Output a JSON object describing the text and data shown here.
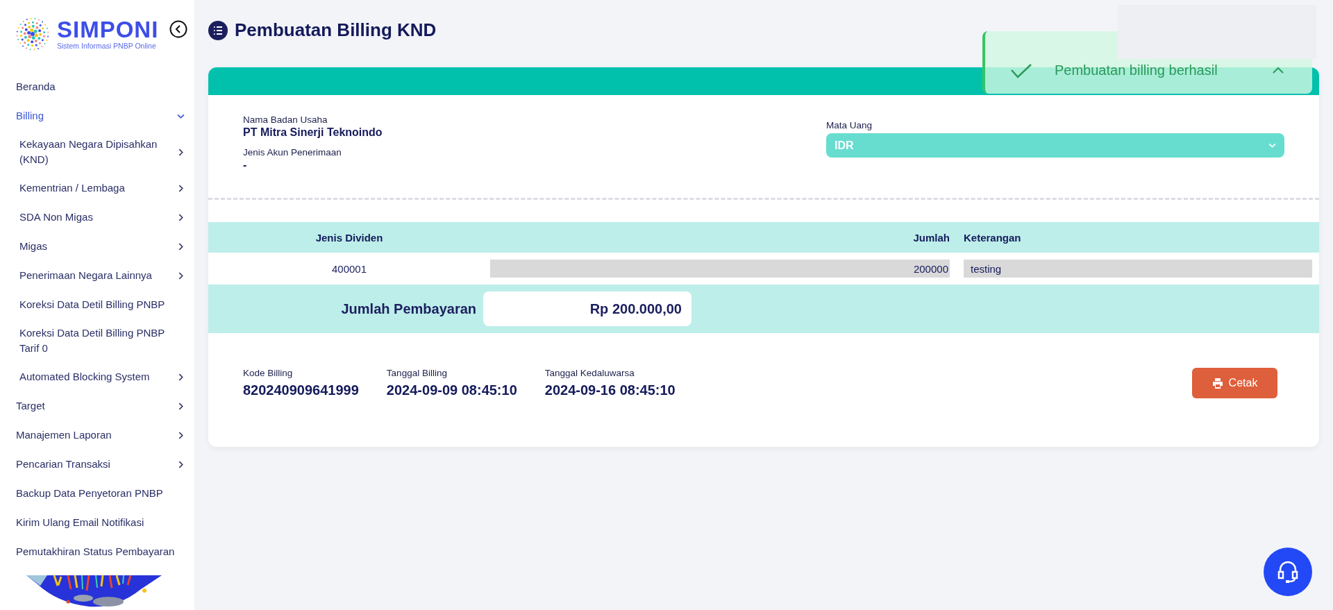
{
  "logo": {
    "name": "SIMPONI",
    "tagline": "Sistem Informasi PNBP Online"
  },
  "sidebar": {
    "items": [
      {
        "label": "Beranda",
        "selected": false
      },
      {
        "label": "Billing",
        "selected": true,
        "expanded": true,
        "children": [
          {
            "label": "Kekayaan Negara Dipisahkan (KND)",
            "selected": false,
            "expanded": false
          },
          {
            "label": "Kementrian / Lembaga",
            "selected": false,
            "expanded": false
          },
          {
            "label": "SDA Non Migas",
            "selected": false,
            "expanded": false
          },
          {
            "label": "Migas",
            "selected": false,
            "expanded": false
          },
          {
            "label": "Penerimaan Negara Lainnya",
            "selected": false,
            "expanded": false
          },
          {
            "label": "Koreksi Data Detil Billing PNBP",
            "selected": false
          },
          {
            "label": "Koreksi Data Detil Billing PNBP Tarif 0",
            "selected": false
          },
          {
            "label": "Automated Blocking System",
            "selected": false,
            "expanded": false
          }
        ]
      },
      {
        "label": "Target",
        "selected": false,
        "expanded": false
      },
      {
        "label": "Manajemen Laporan",
        "selected": false,
        "expanded": false
      },
      {
        "label": "Pencarian Transaksi",
        "selected": false,
        "expanded": false
      },
      {
        "label": "Backup Data Penyetoran PNBP",
        "selected": false
      },
      {
        "label": "Kirim Ulang Email Notifikasi",
        "selected": false
      },
      {
        "label": "Pemutakhiran Status Pembayaran",
        "selected": false
      }
    ]
  },
  "page_title": "Pembuatan Billing KND",
  "toast": {
    "message": "Pembuatan billing berhasil"
  },
  "form": {
    "fields": [
      {
        "label": "Nama Badan Usaha",
        "value": "PT Mitra Sinerji Teknoindo"
      },
      {
        "label": "Jenis Akun Penerimaan",
        "value": "-"
      }
    ],
    "currency": {
      "label": "Mata Uang",
      "value": "IDR"
    }
  },
  "table": {
    "columns": [
      "Jenis Dividen",
      "Jumlah",
      "Keterangan"
    ],
    "rows": [
      {
        "jenis_dividen": "400001",
        "jumlah": "200000",
        "keterangan": "testing"
      }
    ],
    "total": {
      "label": "Jumlah Pembayaran",
      "value": "Rp 200.000,00"
    }
  },
  "billing": [
    {
      "label": "Kode Billing",
      "value": "820240909641999"
    },
    {
      "label": "Tanggal Billing",
      "value": "2024-09-09 08:45:10"
    },
    {
      "label": "Tanggal Kedaluwarsa",
      "value": "2024-09-16 08:45:10"
    }
  ],
  "print_button": "Cetak"
}
